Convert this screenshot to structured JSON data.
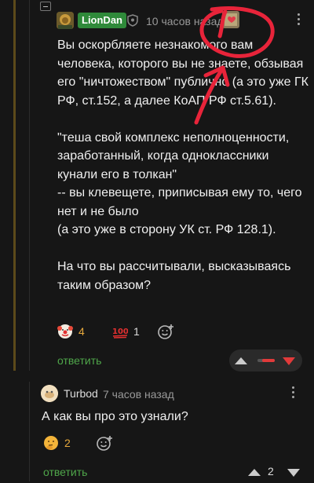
{
  "comment1": {
    "author": "LionDan",
    "time": "10 часов назад",
    "paragraphs": [
      "Вы оскорбляете незнакомого вам человека, которого вы не знаете, обзывая его \"ничтожеством\" публично (а это уже ГК РФ, ст.152, а далее КоАП РФ ст.5.61).",
      "\"теша свой комплекс неполноценности, заработанный, когда одноклассники кунали его в толкан\"",
      "-- вы клевещете, приписывая ему то, чего нет и не было",
      "(а это уже в сторону УК ст. РФ 128.1).",
      "На что вы рассчитывали, высказываясь таким образом?"
    ],
    "reactions": [
      {
        "emoji": "clown-emoji",
        "count": "4"
      },
      {
        "emoji": "hundred-emoji",
        "count": "1"
      }
    ],
    "reply_label": "ответить",
    "colors": {
      "author_badge": "#2f8a3a",
      "reply": "#4fa64a",
      "reaction_count": "#e7a93c",
      "downvote": "#e13a3a"
    }
  },
  "comment2": {
    "author": "Turbod",
    "time": "7 часов назад",
    "text": "А как вы про это узнали?",
    "reactions": [
      {
        "emoji": "thinking-emoji",
        "count": "2"
      }
    ],
    "reply_label": "ответить",
    "score": "2"
  },
  "annotation": {
    "color": "#e8243a",
    "description": "red hand-drawn circle and arrow"
  }
}
